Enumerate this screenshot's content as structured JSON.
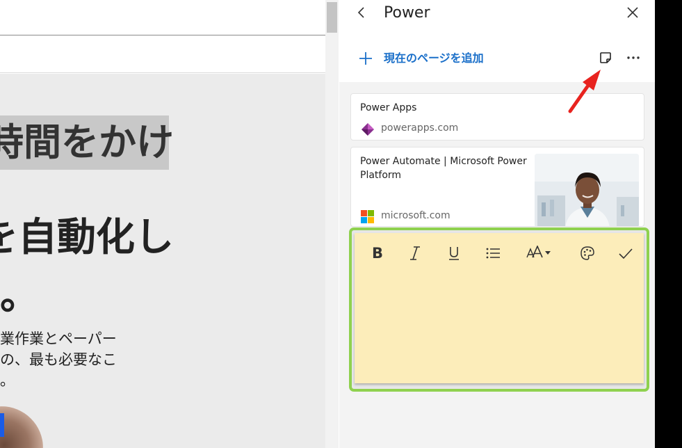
{
  "page": {
    "headline_line1": "時間をかけ",
    "headline_line2": "を自動化し",
    "headline_line3": "。",
    "body_lines": [
      "業作業とペーパー",
      "の、最も必要なこ",
      "。"
    ]
  },
  "panel": {
    "title": "Power",
    "add_current_page_label": "現在のページを追加",
    "icons": {
      "back": "chevron-left-icon",
      "close": "close-icon",
      "add": "plus-icon",
      "note": "sticky-note-icon",
      "more": "more-icon"
    },
    "items": [
      {
        "title": "Power Apps",
        "domain": "powerapps.com",
        "favicon": "power-apps-icon"
      },
      {
        "title": "Power Automate | Microsoft Power Platform",
        "domain": "microsoft.com",
        "favicon": "microsoft-logo-icon",
        "has_thumbnail": true
      }
    ]
  },
  "note_editor": {
    "tools": [
      "bold",
      "italic",
      "underline",
      "bullet-list",
      "text-size",
      "palette",
      "done"
    ],
    "bold_label": "B",
    "text": "",
    "background_color": "#fcedba",
    "highlight_color": "#8fd14f"
  },
  "annotation": {
    "arrow_color": "#e8231f"
  },
  "colors": {
    "accent": "#1a6fc9"
  }
}
